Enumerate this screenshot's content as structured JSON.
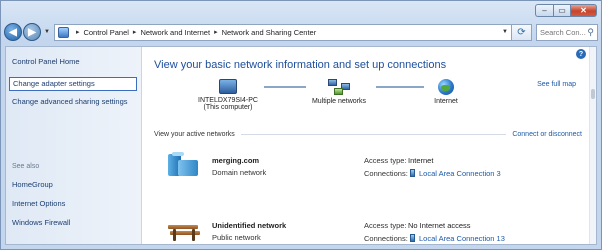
{
  "window": {
    "caption": {
      "minimize": "–",
      "maximize": "▭",
      "close": "✕"
    }
  },
  "nav": {
    "back": "◀",
    "forward": "▶",
    "breadcrumbs": [
      "Control Panel",
      "Network and Internet",
      "Network and Sharing Center"
    ],
    "search_placeholder": "Search Con..."
  },
  "sidebar": {
    "home": "Control Panel Home",
    "change_adapter": "Change adapter settings",
    "change_advanced": "Change advanced sharing settings",
    "see_also_title": "See also",
    "see_also": [
      "HomeGroup",
      "Internet Options",
      "Windows Firewall"
    ]
  },
  "main": {
    "title": "View your basic network information and set up connections",
    "see_full_map": "See full map",
    "map": {
      "computer_name": "INTELDX79SI4-PC",
      "computer_sub": "(This computer)",
      "middle": "Multiple networks",
      "internet": "Internet"
    },
    "active_heading": "View your active networks",
    "connect_link": "Connect or disconnect",
    "networks": [
      {
        "name": "merging.com",
        "category": "Domain network",
        "access_label": "Access type:",
        "access_value": "Internet",
        "connections_label": "Connections:",
        "connection": "Local Area Connection 3"
      },
      {
        "name": "Unidentified network",
        "category": "Public network",
        "access_label": "Access type:",
        "access_value": "No Internet access",
        "connections_label": "Connections:",
        "connection": "Local Area Connection 13"
      }
    ]
  },
  "colors": {
    "link": "#1c5aa8",
    "title": "#1e4f9c",
    "close_button": "#c6442d"
  }
}
